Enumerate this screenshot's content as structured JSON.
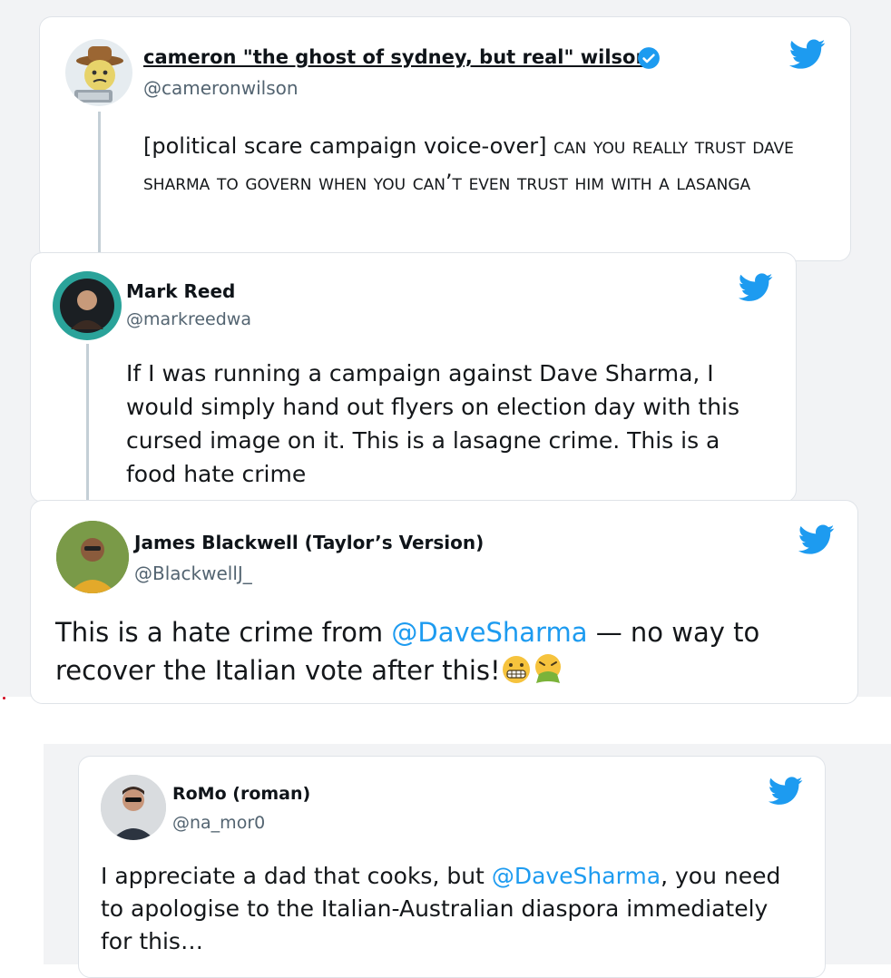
{
  "colors": {
    "link": "#1d9bf0",
    "verified": "#1d9bf0",
    "bird": "#1d9bf0",
    "handle": "#536471"
  },
  "tweets": [
    {
      "name": "cameron \"the ghost of sydney, but real\" wilson",
      "handle": "@cameronwilson",
      "verified": true,
      "avatar_icon": "cowboy-emoji-avatar",
      "text_prefix": "[political scare campaign voice-over] ",
      "text_caps": "can you really trust dave sharma to govern when you can’t even trust him with a lasanga"
    },
    {
      "name": "Mark Reed",
      "handle": "@markreedwa",
      "avatar_icon": "photo-avatar",
      "text": "If I was running a campaign against Dave Sharma, I would simply hand out flyers on election day with this cursed image on it. This is a lasagne crime. This is a food hate crime"
    },
    {
      "name": "James Blackwell (Taylor’s Version)",
      "handle": "@BlackwellJ_",
      "avatar_icon": "photo-avatar",
      "text_before": "This is a hate crime from ",
      "mention": "@DaveSharma",
      "text_after": " — no way to recover the Italian vote after this!",
      "emojis": [
        "grimacing-face-emoji",
        "vomiting-face-emoji"
      ]
    },
    {
      "name": "RoMo (roman)",
      "handle": "@na_mor0",
      "avatar_icon": "photo-avatar",
      "text_before": "I appreciate a dad that cooks, but ",
      "mention": "@DaveSharma",
      "text_after": ", you need to apologise to the Italian-Australian diaspora immediately for this…"
    }
  ]
}
